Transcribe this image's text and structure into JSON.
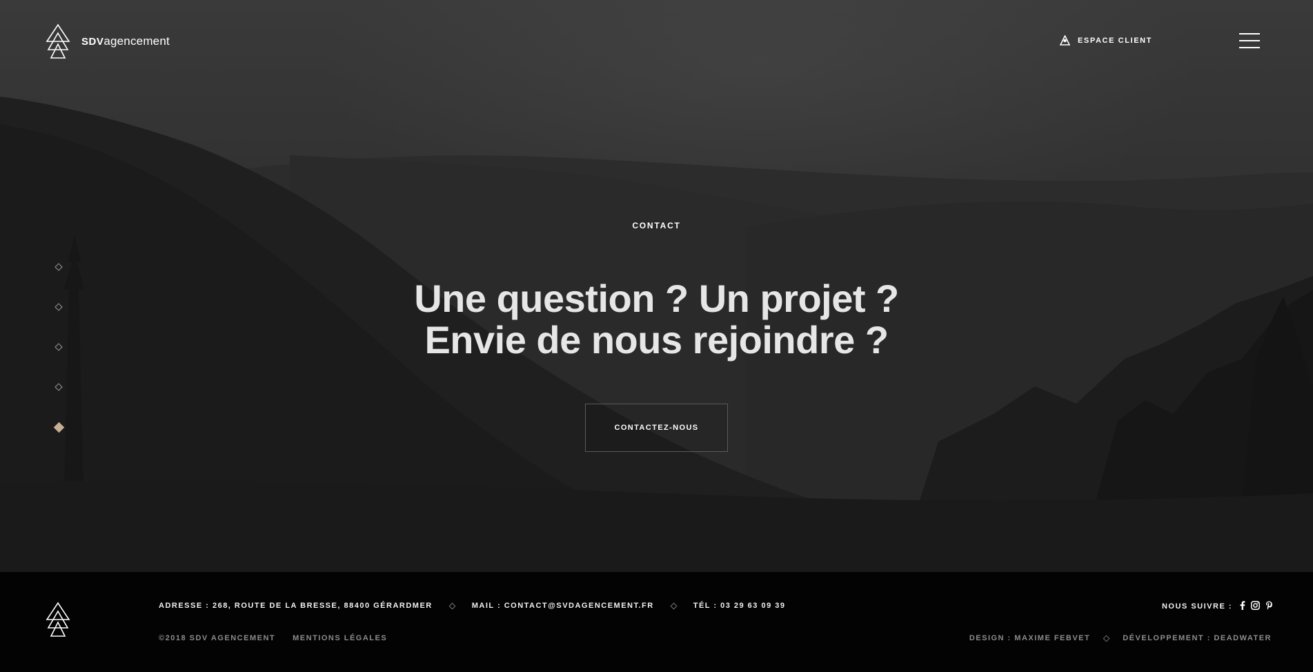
{
  "header": {
    "logo_bold": "SDV",
    "logo_light": "agencement",
    "espace_client_label": "ESPACE CLIENT",
    "menu_icon": "hamburger-menu-icon"
  },
  "side_nav": {
    "count": 5,
    "active_index": 4,
    "accent_color": "#c5b097"
  },
  "hero": {
    "eyebrow": "CONTACT",
    "headline_line1": "Une question ? Un projet ?",
    "headline_line2": "Envie de nous rejoindre ?",
    "cta_label": "CONTACTEZ-NOUS"
  },
  "footer": {
    "address": "ADRESSE : 268, ROUTE DE LA BRESSE, 88400 GÉRARDMER",
    "mail": "MAIL : CONTACT@SVDAGENCEMENT.FR",
    "tel": "TÉL : 03 29 63 09 39",
    "copyright": "©2018 SDV AGENCEMENT",
    "mentions": "MENTIONS LÉGALES",
    "follow_label": "NOUS SUIVRE :",
    "social_icons": [
      "facebook-icon",
      "instagram-icon",
      "pinterest-icon"
    ],
    "design_credit": "DESIGN : MAXIME FEBVET",
    "dev_credit": "DÉVELOPPEMENT : DEADWATER"
  }
}
